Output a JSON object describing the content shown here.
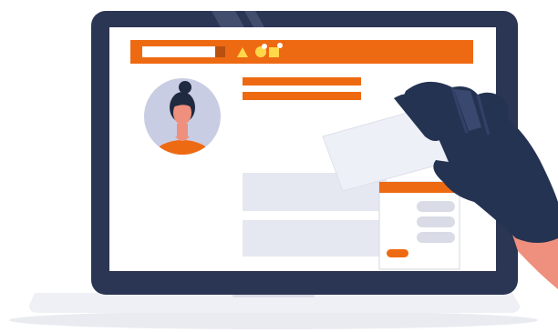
{
  "illustration": {
    "colors": {
      "laptop_bezel": "#2b3554",
      "laptop_base": "#eef0f5",
      "screen": "#ffffff",
      "accent": "#ee6a12",
      "placeholder": "#e5e8f0",
      "avatar_bg": "#c9cde4",
      "skin": "#ef8f7d",
      "hair": "#1f2940",
      "glove": "#253352",
      "card": "#eef0f8",
      "shadow": "#e9ebf1"
    },
    "icons": [
      "search-bar-icon",
      "triangle-icon",
      "circle-icon",
      "square-icon",
      "user-avatar-icon",
      "gloved-hand-icon",
      "id-card-icon"
    ],
    "popup": {
      "button_label": ""
    }
  }
}
